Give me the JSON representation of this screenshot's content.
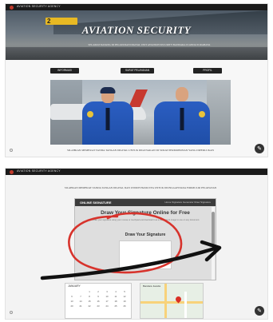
{
  "site": {
    "brand": "AVIATION SECURITY AGENCY"
  },
  "hero": {
    "sign_number": "2",
    "title": "AVIATION SECURITY",
    "subtitle": "SELAMAT DATANG DI PELAYANAN DIGITAL UNIT AVIATION SECURITY BANDARA JUANDA SURABAYA"
  },
  "nav_buttons": [
    {
      "label": "INFORMASI"
    },
    {
      "label": "SURAT PELAYANAN"
    },
    {
      "label": "PROFIL"
    }
  ],
  "caption_top": "SILAHKAN MEMBUAT TANDA TANGAN DIGITAL UNTUK DIGUNAKAN DI SURAT PERMOHONAN YANG DIPERLUKAN",
  "caption_bottom": "SILAHKAN MEMBUAT TANDA TANGAN DIGITAL DAN UNDUH HASILNYA UNTUK DIUNGGAH PADA FORMULIR PELAYANAN",
  "embedded_page": {
    "logo": "ONLINE SIGNATURE",
    "nav_links": "Home   Signature Generator   Draw Signature",
    "heading": "Draw Your Signature Online for Free",
    "description": "Draw your signature using your mouse or touchpad and download it as a transparent image to use on any document.",
    "pad_heading": "Draw Your Signature"
  },
  "calendar": {
    "header": "JANUARY",
    "cells": [
      "",
      "",
      "1",
      "2",
      "3",
      "4",
      "5",
      "6",
      "7",
      "8",
      "9",
      "10",
      "11",
      "12",
      "13",
      "14",
      "15",
      "16",
      "17",
      "18",
      "19",
      "20",
      "21",
      "22",
      "23",
      "24",
      "25",
      "26"
    ]
  },
  "map": {
    "title": "Bandara Juanda"
  },
  "icons": {
    "edit": "pencil-icon"
  },
  "colors": {
    "topbar": "#1b1b1b",
    "uniform": "#2b5ec2",
    "annotation_circle": "#d7332c",
    "annotation_arrow": "#111111"
  }
}
